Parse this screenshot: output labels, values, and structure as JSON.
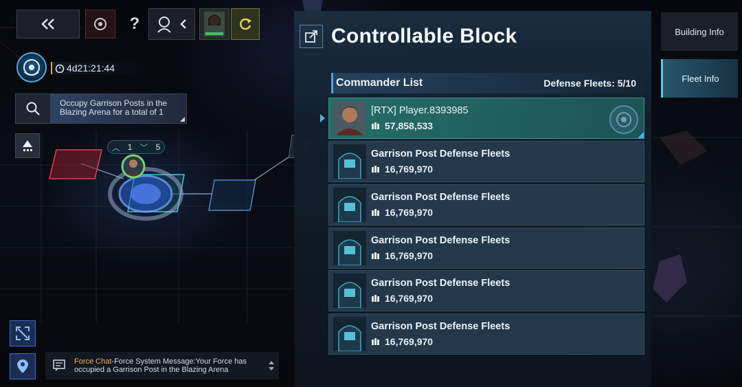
{
  "hud": {
    "timer": "4d21:21:44",
    "mission_text": "Occupy Garrison Posts in the Blazing Arena for a total of 1",
    "node_up_count": "1",
    "node_down_count": "5",
    "question_node": "?"
  },
  "chat": {
    "channel": "Force Chat",
    "message": "-Force System Message:Your Force has occupied a Garrison Post in the Blazing Arena"
  },
  "panel": {
    "title": "Controllable Block",
    "list_title": "Commander List",
    "defense_fleets": "Defense Fleets: 5/10",
    "rows": [
      {
        "name": "[RTX] Player.8393985",
        "power": "57,858,533",
        "selected": true
      },
      {
        "name": "Garrison Post Defense Fleets",
        "power": "16,769,970"
      },
      {
        "name": "Garrison Post Defense Fleets",
        "power": "16,769,970"
      },
      {
        "name": "Garrison Post Defense Fleets",
        "power": "16,769,970"
      },
      {
        "name": "Garrison Post Defense Fleets",
        "power": "16,769,970"
      },
      {
        "name": "Garrison Post Defense Fleets",
        "power": "16,769,970"
      }
    ]
  },
  "tabs": {
    "building_info": "Building Info",
    "fleet_info": "Fleet Info",
    "active": "Fleet Info"
  },
  "colors": {
    "accent": "#4fa3e0",
    "selected_row": "#2a7870",
    "chat_channel": "#f2b35a"
  }
}
